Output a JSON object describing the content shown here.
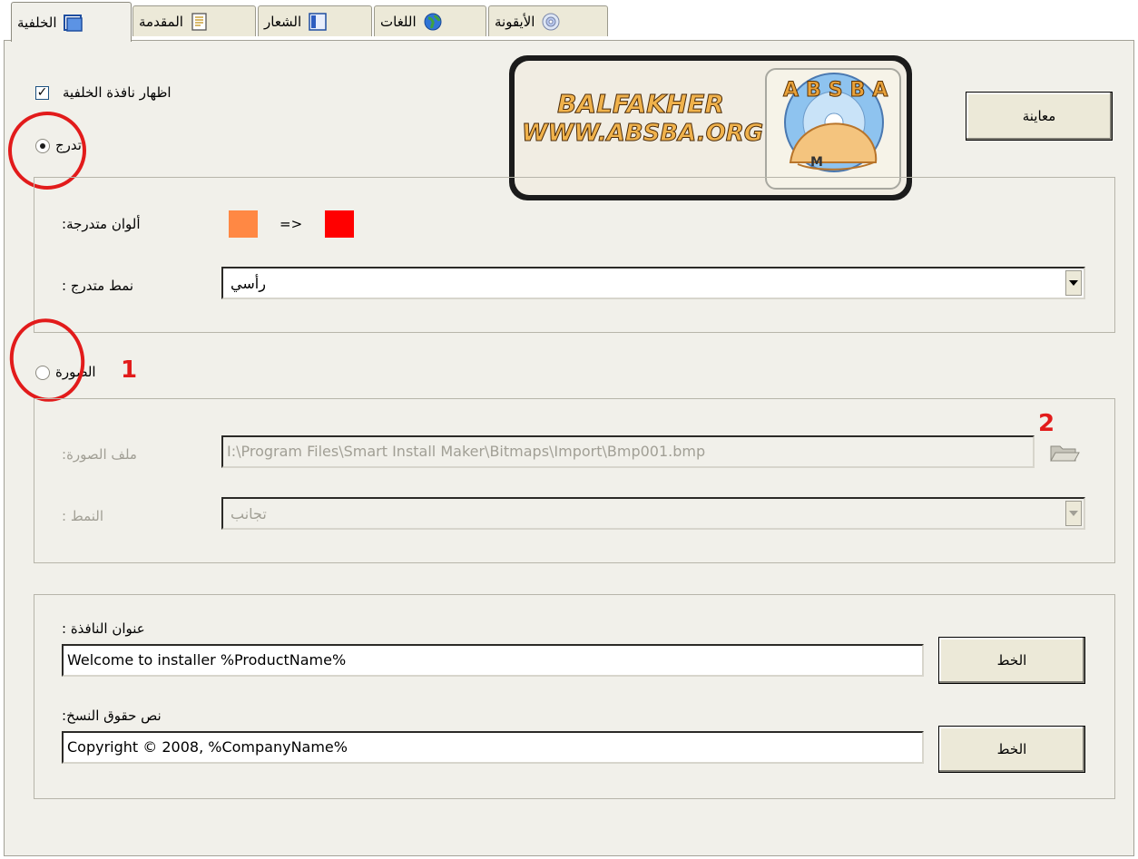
{
  "tabs": [
    {
      "label": "الخلفية",
      "icon": "background-window-icon",
      "active": true
    },
    {
      "label": "المقدمة",
      "icon": "document-icon",
      "active": false
    },
    {
      "label": "الشعار",
      "icon": "banner-icon",
      "active": false
    },
    {
      "label": "اللغات",
      "icon": "globe-icon",
      "active": false
    },
    {
      "label": "الأيقونة",
      "icon": "cd-icon",
      "active": false
    }
  ],
  "background": {
    "show_window_label": "اظهار نافذة الخلفية",
    "show_window_checked": true,
    "preview_button": "معاينة",
    "logo": {
      "line1": "BALFAKHER",
      "line2": "WWW.ABSBA.ORG",
      "badge": "ABSBA",
      "badge_letter": "M"
    },
    "gradient_radio_label": "تدرج",
    "gradient_selected": true,
    "gradient_colors_label": ":ألوان متدرجة",
    "gradient_arrow": "=>",
    "gradient_color_from": "#ff8844",
    "gradient_color_to": "#ff0000",
    "gradient_style_label": ": نمط متدرج",
    "gradient_style_value": "رأسي",
    "image_radio_label": "الصورة",
    "image_selected": false,
    "image_file_label": ":ملف الصورة",
    "image_file_value": "I:\\Program Files\\Smart Install Maker\\Bitmaps\\Import\\Bmp001.bmp",
    "image_style_label": ": النمط",
    "image_style_value": "تجانب"
  },
  "window_text": {
    "title_label": ": عنوان النافذة",
    "title_value": "Welcome to installer %ProductName%",
    "title_font_button": "الخط",
    "copyright_label": ":نص حقوق النسخ",
    "copyright_value": "Copyright © 2008, %CompanyName%",
    "copyright_font_button": "الخط"
  },
  "annotations": {
    "marker_1": "1",
    "marker_2": "2",
    "color": "#e21b1b"
  }
}
